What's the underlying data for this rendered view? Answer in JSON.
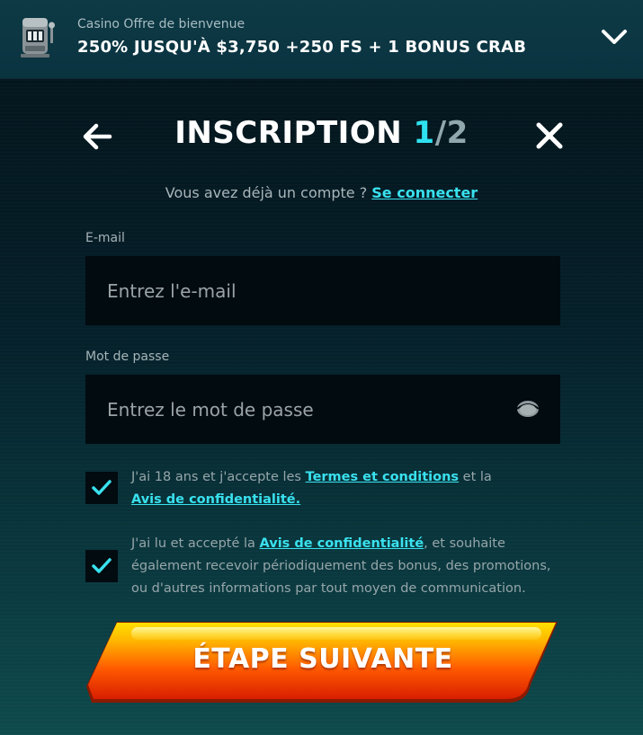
{
  "banner": {
    "subtitle": "Casino Offre de bienvenue",
    "offer": "250% JUSQU'À $3,750 +250 FS + 1 BONUS CRAB",
    "icon": "slot-machine-icon",
    "toggle_icon": "chevron-down-icon"
  },
  "header": {
    "title": "INSCRIPTION ",
    "step_current": "1",
    "step_separator": "/",
    "step_total": "2",
    "back_icon": "arrow-left-icon",
    "close_icon": "close-icon"
  },
  "login": {
    "prompt": "Vous avez déjà un compte ? ",
    "link": "Se connecter"
  },
  "form": {
    "email": {
      "label": "E-mail",
      "placeholder": "Entrez l'e-mail",
      "value": ""
    },
    "password": {
      "label": "Mot de passe",
      "placeholder": "Entrez le mot de passe",
      "value": "",
      "toggle_icon": "eye-icon"
    }
  },
  "consents": [
    {
      "checked": true,
      "text_before": "J'ai 18 ans et j'accepte les ",
      "link1": "Termes et conditions",
      "text_middle": " et la ",
      "link2": "Avis de confidentialité."
    },
    {
      "checked": true,
      "text_before": "J'ai lu et accepté la ",
      "link1": "Avis de confidentialité",
      "text_after": ", et souhaite également recevoir périodiquement des bonus, des promotions, ou d'autres informations par tout moyen de communication."
    }
  ],
  "cta": {
    "label": "ÉTAPE SUIVANTE"
  },
  "colors": {
    "accent": "#39e1ee",
    "cta_top": "#ffd200",
    "cta_bottom": "#e62a00",
    "input_bg": "#020b10"
  }
}
